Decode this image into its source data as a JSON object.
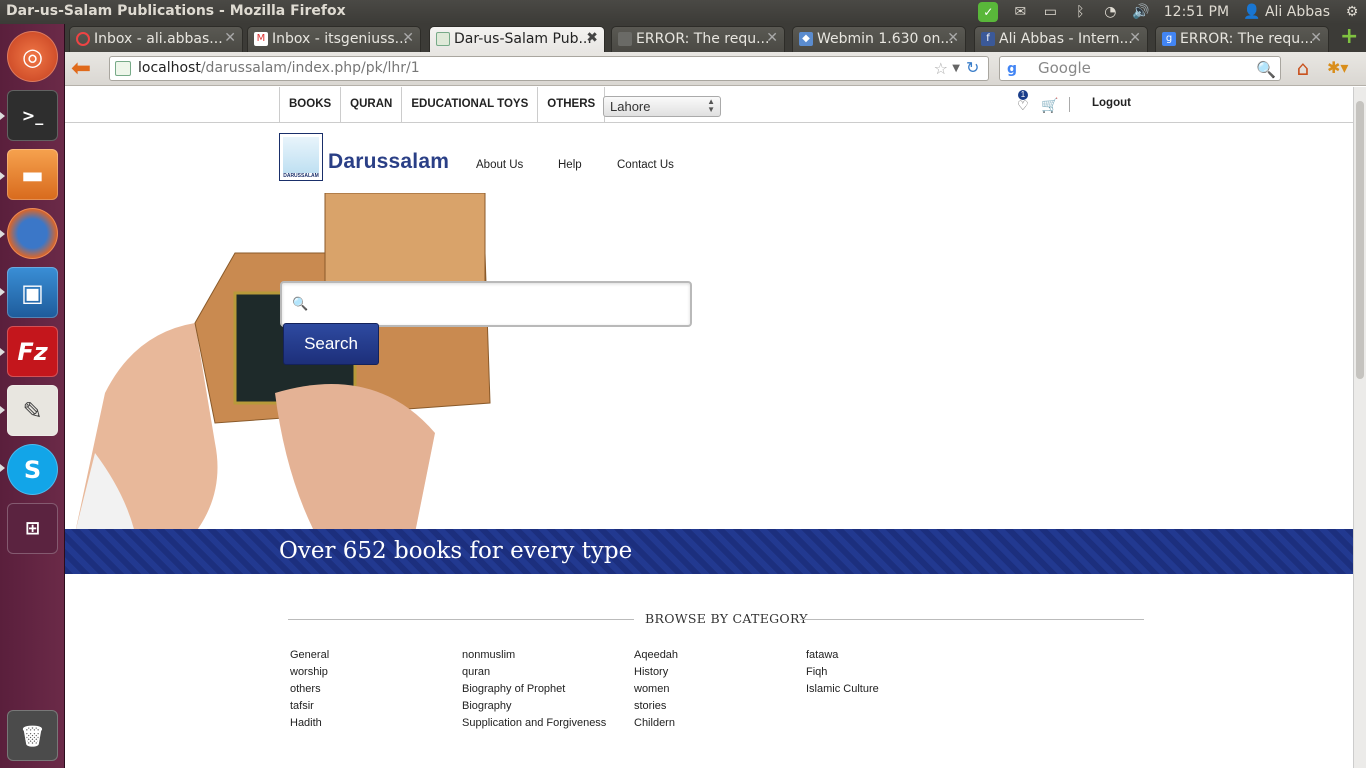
{
  "top_panel": {
    "window_title": "Dar-us-Salam Publications - Mozilla Firefox",
    "clock": "12:51 PM",
    "user": "Ali Abbas"
  },
  "launcher": {
    "apps": [
      "ubuntu-dash",
      "terminal",
      "files",
      "firefox",
      "virtualbox",
      "filezilla",
      "text-editor",
      "skype",
      "workspace-switcher",
      "trash"
    ]
  },
  "browser": {
    "tabs": [
      {
        "label": "Inbox - ali.abbas...",
        "icon": "loading-icon"
      },
      {
        "label": "Inbox - itsgeniuss...",
        "icon": "gmail-icon"
      },
      {
        "label": "Dar-us-Salam Pub...",
        "icon": "darussalam-icon",
        "active": true
      },
      {
        "label": "ERROR: The requ...",
        "icon": "page-icon"
      },
      {
        "label": "Webmin 1.630 on...",
        "icon": "webmin-icon"
      },
      {
        "label": "Ali Abbas - Intern...",
        "icon": "facebook-icon"
      },
      {
        "label": "ERROR: The requ...",
        "icon": "google-icon"
      }
    ],
    "url_host": "localhost",
    "url_path": "/darussalam/index.php/pk/lhr/1",
    "search_placeholder": "Google"
  },
  "site": {
    "categories_menu": [
      "BOOKS",
      "QURAN",
      "EDUCATIONAL TOYS",
      "OTHERS"
    ],
    "city_selected": "Lahore",
    "wishlist_count": "1",
    "logout_label": "Logout",
    "brand_name": "Darussalam",
    "logo_caption": "DARUSSALAM",
    "links": [
      "About Us",
      "Help",
      "Contact Us"
    ],
    "search_value": "",
    "search_button": "Search",
    "banner_text": "Over 652 books for every type",
    "browse_heading": "BROWSE BY CATEGORY",
    "category_columns": [
      [
        "General",
        "worship",
        "others",
        "tafsir",
        "Hadith"
      ],
      [
        "nonmuslim",
        "quran",
        "Biography of Prophet",
        "Biography",
        "Supplication and Forgiveness"
      ],
      [
        "Aqeedah",
        "History",
        "women",
        "stories",
        "Childern"
      ],
      [
        "fatawa",
        "Fiqh",
        "Islamic Culture"
      ]
    ],
    "brand_color": "#2a3f86",
    "banner_color": "#1c2f7e"
  }
}
